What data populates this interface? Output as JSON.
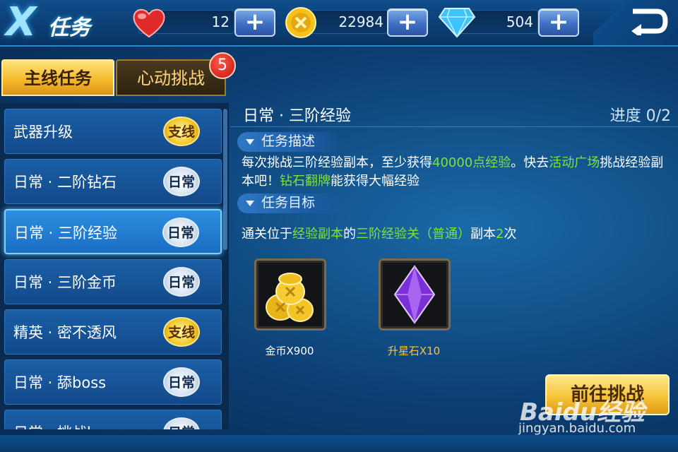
{
  "header": {
    "logo_letter": "X",
    "title": "任务",
    "hearts": "12",
    "coins": "22984",
    "gems": "504",
    "plus_label": "+"
  },
  "tabs": [
    {
      "label": "主线任务",
      "active": true
    },
    {
      "label": "心动挑战",
      "active": false,
      "badge": "5"
    }
  ],
  "tasks": [
    {
      "label": "武器升级",
      "tag": "支线"
    },
    {
      "label": "日常 · 二阶钻石",
      "tag": "日常"
    },
    {
      "label": "日常 · 三阶经验",
      "tag": "日常",
      "selected": true
    },
    {
      "label": "日常 · 三阶金币",
      "tag": "日常"
    },
    {
      "label": "精英 · 密不透风",
      "tag": "支线"
    },
    {
      "label": "日常 · 舔boss",
      "tag": "日常"
    },
    {
      "label": "日常 · 挑战b",
      "tag": "日常"
    }
  ],
  "detail": {
    "title": "日常 · 三阶经验",
    "progress": "进度 0/2",
    "desc_header": "任务描述",
    "desc": {
      "p1": "每次挑战三阶经验副本，至少获得",
      "h1": "40000点经验",
      "p2": "。快去",
      "h2": "活动广场",
      "p3": "挑战经验副本吧！",
      "h3": "钻石翻牌",
      "p4": "能获得大幅经验"
    },
    "goal_header": "任务目标",
    "goal": {
      "p1": "通关位于",
      "h1": "经验副本",
      "p2": "的",
      "h2": "三阶经验关（普通）",
      "p3": "副本",
      "h3": "2",
      "p4": "次"
    },
    "rewards": [
      {
        "icon": "gold-coins-icon",
        "label": "金币X900",
        "label_color": "#ffffff"
      },
      {
        "icon": "star-stone-icon",
        "label": "升星石X10",
        "label_color": "#f6c431"
      }
    ],
    "go_button": "前往挑战"
  },
  "watermark": {
    "brand": "Baidu经验",
    "url": "jingyan.baidu.com"
  },
  "colors": {
    "highlight_green": "#7de33a",
    "gold": "#f3b728"
  }
}
